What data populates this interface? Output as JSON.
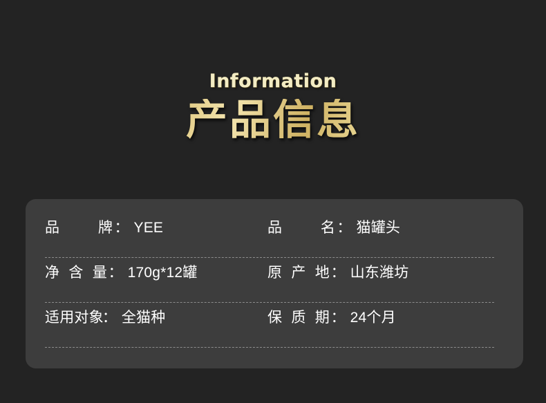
{
  "page": {
    "background_color": "#232323",
    "card_background_color": "#3d3d3d",
    "gold_color": "#e2cb82",
    "cream_color": "#f3ecc4",
    "divider_color": "#8d8d8d"
  },
  "heading": {
    "eyebrow": "Information",
    "title": "产品信息"
  },
  "info_card": {
    "rows": [
      {
        "left": {
          "label": "品　　牌",
          "colon": "：",
          "value": "YEE"
        },
        "right": {
          "label": "品　　名",
          "colon": "：",
          "value": "猫罐头"
        }
      },
      {
        "left": {
          "label": "净 含 量",
          "colon": "：",
          "value": "170g*12罐"
        },
        "right": {
          "label": "原 产 地",
          "colon": "：",
          "value": "山东潍坊"
        }
      },
      {
        "left": {
          "label": "适用对象",
          "colon": "：",
          "value": "全猫种"
        },
        "right": {
          "label": "保 质 期",
          "colon": "：",
          "value": "24个月"
        }
      }
    ]
  }
}
